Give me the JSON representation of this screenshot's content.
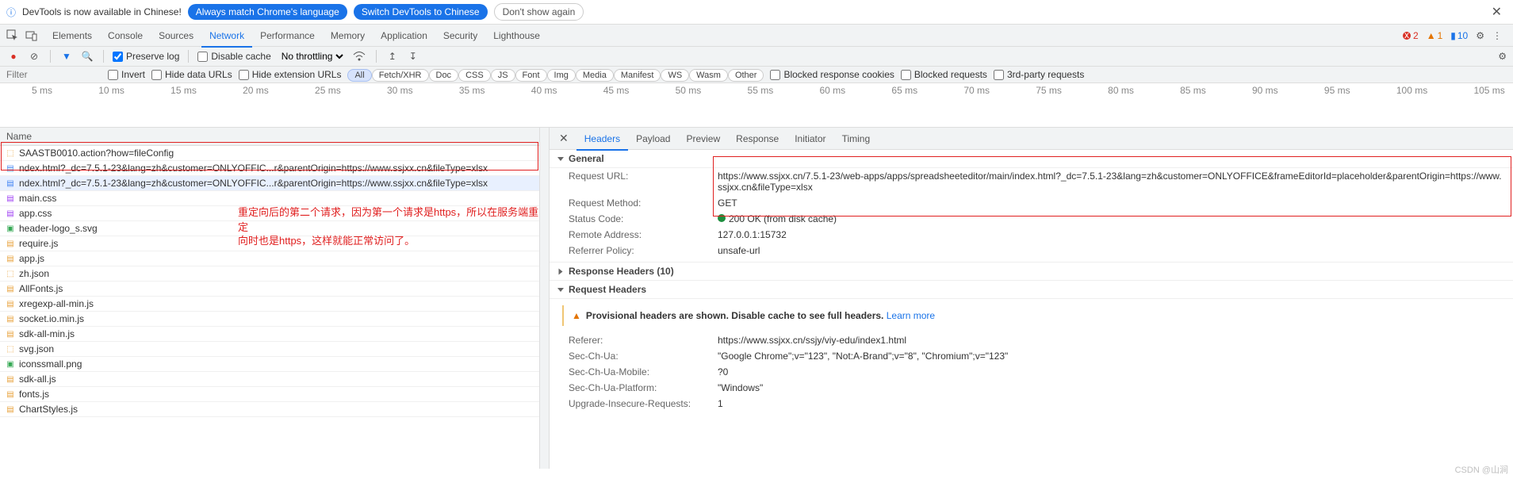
{
  "infobar": {
    "text": "DevTools is now available in Chinese!",
    "pill1": "Always match Chrome's language",
    "pill2": "Switch DevTools to Chinese",
    "pill3": "Don't show again"
  },
  "tabs": [
    "Elements",
    "Console",
    "Sources",
    "Network",
    "Performance",
    "Memory",
    "Application",
    "Security",
    "Lighthouse"
  ],
  "tab_active": "Network",
  "errors": {
    "red": "2",
    "amber": "1",
    "blue": "10"
  },
  "toolbar": {
    "preserve": "Preserve log",
    "disable_cache": "Disable cache",
    "throttling": "No throttling"
  },
  "filterbar": {
    "filter_ph": "Filter",
    "invert": "Invert",
    "hide_data": "Hide data URLs",
    "hide_ext": "Hide extension URLs",
    "chips": [
      "All",
      "Fetch/XHR",
      "Doc",
      "CSS",
      "JS",
      "Font",
      "Img",
      "Media",
      "Manifest",
      "WS",
      "Wasm",
      "Other"
    ],
    "chip_sel": "All",
    "blocked_cookies": "Blocked response cookies",
    "blocked_req": "Blocked requests",
    "third_party": "3rd-party requests"
  },
  "ticks": [
    "5 ms",
    "10 ms",
    "15 ms",
    "20 ms",
    "25 ms",
    "30 ms",
    "35 ms",
    "40 ms",
    "45 ms",
    "50 ms",
    "55 ms",
    "60 ms",
    "65 ms",
    "70 ms",
    "75 ms",
    "80 ms",
    "85 ms",
    "90 ms",
    "95 ms",
    "100 ms",
    "105 ms"
  ],
  "name_col": "Name",
  "requests": [
    {
      "n": "SAASTB0010.action?how=fileConfig",
      "t": "xhr"
    },
    {
      "n": "ndex.html?_dc=7.5.1-23&lang=zh&customer=ONLYOFFIC...r&parentOrigin=https://www.ssjxx.cn&fileType=xlsx",
      "t": "doc",
      "sel": false
    },
    {
      "n": "ndex.html?_dc=7.5.1-23&lang=zh&customer=ONLYOFFIC...r&parentOrigin=https://www.ssjxx.cn&fileType=xlsx",
      "t": "doc",
      "sel": true
    },
    {
      "n": "main.css",
      "t": "css"
    },
    {
      "n": "app.css",
      "t": "css"
    },
    {
      "n": "header-logo_s.svg",
      "t": "img"
    },
    {
      "n": "require.js",
      "t": "js"
    },
    {
      "n": "app.js",
      "t": "js"
    },
    {
      "n": "zh.json",
      "t": "xhr"
    },
    {
      "n": "AllFonts.js",
      "t": "js"
    },
    {
      "n": "xregexp-all-min.js",
      "t": "js"
    },
    {
      "n": "socket.io.min.js",
      "t": "js"
    },
    {
      "n": "sdk-all-min.js",
      "t": "js"
    },
    {
      "n": "svg.json",
      "t": "xhr"
    },
    {
      "n": "iconssmall.png",
      "t": "img"
    },
    {
      "n": "sdk-all.js",
      "t": "js"
    },
    {
      "n": "fonts.js",
      "t": "js"
    },
    {
      "n": "ChartStyles.js",
      "t": "js"
    }
  ],
  "anno1": "重定向后的第二个请求，因为第一个请求是https，所以在服务端重定",
  "anno2": "向时也是https，这样就能正常访问了。",
  "detail_tabs": [
    "Headers",
    "Payload",
    "Preview",
    "Response",
    "Initiator",
    "Timing"
  ],
  "dtab_active": "Headers",
  "sections": {
    "general": "General",
    "resp_h": "Response Headers (10)",
    "req_h": "Request Headers"
  },
  "general": {
    "url_k": "Request URL:",
    "url_v": "https://www.ssjxx.cn/7.5.1-23/web-apps/apps/spreadsheeteditor/main/index.html?_dc=7.5.1-23&lang=zh&customer=ONLYOFFICE&frameEditorId=placeholder&parentOrigin=https://www.ssjxx.cn&fileType=xlsx",
    "method_k": "Request Method:",
    "method_v": "GET",
    "status_k": "Status Code:",
    "status_v": "200 OK (from disk cache)",
    "remote_k": "Remote Address:",
    "remote_v": "127.0.0.1:15732",
    "refp_k": "Referrer Policy:",
    "refp_v": "unsafe-url"
  },
  "warn": {
    "bold": "Provisional headers are shown. Disable cache to see full headers.",
    "link": "Learn more"
  },
  "req_headers": [
    {
      "k": "Referer:",
      "v": "https://www.ssjxx.cn/ssjy/viy-edu/index1.html"
    },
    {
      "k": "Sec-Ch-Ua:",
      "v": "\"Google Chrome\";v=\"123\", \"Not:A-Brand\";v=\"8\", \"Chromium\";v=\"123\""
    },
    {
      "k": "Sec-Ch-Ua-Mobile:",
      "v": "?0"
    },
    {
      "k": "Sec-Ch-Ua-Platform:",
      "v": "\"Windows\""
    },
    {
      "k": "Upgrade-Insecure-Requests:",
      "v": "1"
    }
  ],
  "watermark": "CSDN @山涧"
}
